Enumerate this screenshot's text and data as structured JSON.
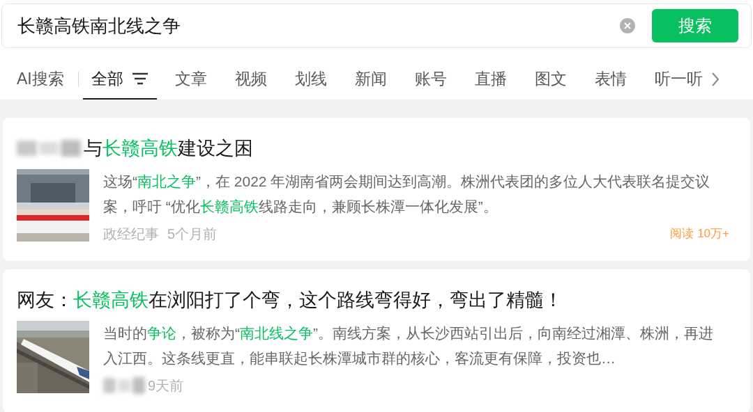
{
  "search": {
    "value": "长赣高铁南北线之争",
    "button": "搜索"
  },
  "tabs": [
    {
      "label": "AI搜索",
      "selected": false,
      "kind": "ai"
    },
    {
      "label": "全部",
      "selected": true,
      "kind": "filter"
    },
    {
      "label": "文章",
      "selected": false,
      "kind": "plain"
    },
    {
      "label": "视频",
      "selected": false,
      "kind": "plain"
    },
    {
      "label": "划线",
      "selected": false,
      "kind": "plain"
    },
    {
      "label": "新闻",
      "selected": false,
      "kind": "plain"
    },
    {
      "label": "账号",
      "selected": false,
      "kind": "plain"
    },
    {
      "label": "直播",
      "selected": false,
      "kind": "plain"
    },
    {
      "label": "图文",
      "selected": false,
      "kind": "plain"
    },
    {
      "label": "表情",
      "selected": false,
      "kind": "plain"
    },
    {
      "label": "听一听",
      "selected": false,
      "kind": "plain"
    }
  ],
  "results": [
    {
      "title_blurred": true,
      "title": [
        {
          "text": "与",
          "highlight": false
        },
        {
          "text": "长赣高铁",
          "highlight": true
        },
        {
          "text": "建设之困",
          "highlight": false
        }
      ],
      "summary": [
        {
          "text": "这场“",
          "highlight": false
        },
        {
          "text": "南北之争",
          "highlight": true
        },
        {
          "text": "”，在 2022 年湖南省两会期间达到高潮。株洲代表团的多位人大代表联名提交议案，呼吁 “优化",
          "highlight": false
        },
        {
          "text": "长赣高铁",
          "highlight": true
        },
        {
          "text": "线路走向，兼顾长株潭一体化发展”。",
          "highlight": false
        }
      ],
      "source_blurred": false,
      "source": "政经纪事",
      "time": "5个月前",
      "reads": "阅读 10万+"
    },
    {
      "title_blurred": false,
      "title": [
        {
          "text": "网友：",
          "highlight": false
        },
        {
          "text": "长赣高铁",
          "highlight": true
        },
        {
          "text": "在浏阳打了个弯，这个路线弯得好，弯出了精髓！",
          "highlight": false
        }
      ],
      "summary": [
        {
          "text": "当时的",
          "highlight": false
        },
        {
          "text": "争论",
          "highlight": true
        },
        {
          "text": "，被称为“",
          "highlight": false
        },
        {
          "text": "南北线之争",
          "highlight": true
        },
        {
          "text": "”。南线方案，从长沙西站引出后，向南经过湘潭、株洲，再进入江西。这条线更直，能串联起长株潭城市群的核心，客流更有保障，投资也…",
          "highlight": false
        }
      ],
      "source_blurred": true,
      "time": "9天前"
    }
  ]
}
